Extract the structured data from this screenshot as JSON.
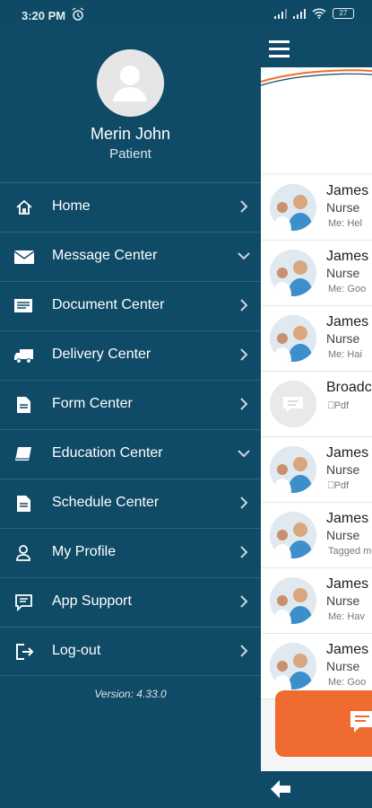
{
  "status": {
    "time": "3:20 PM",
    "battery": "27"
  },
  "drawer": {
    "user_name": "Merin John",
    "user_role": "Patient",
    "menu": [
      {
        "label": "Home",
        "icon": "home-icon",
        "chevron": "right"
      },
      {
        "label": "Message Center",
        "icon": "envelope-icon",
        "chevron": "down"
      },
      {
        "label": "Document Center",
        "icon": "document-icon",
        "chevron": "right"
      },
      {
        "label": "Delivery Center",
        "icon": "truck-icon",
        "chevron": "right"
      },
      {
        "label": "Form Center",
        "icon": "form-icon",
        "chevron": "right"
      },
      {
        "label": "Education Center",
        "icon": "book-icon",
        "chevron": "down"
      },
      {
        "label": "Schedule Center",
        "icon": "schedule-icon",
        "chevron": "right"
      },
      {
        "label": "My Profile",
        "icon": "profile-icon",
        "chevron": "right"
      },
      {
        "label": "App Support",
        "icon": "support-icon",
        "chevron": "right"
      },
      {
        "label": "Log-out",
        "icon": "logout-icon",
        "chevron": "right"
      }
    ],
    "version": "Version: 4.33.0"
  },
  "conversations": [
    {
      "name": "James",
      "role": "Nurse",
      "message": "Me: Hel",
      "type": "person"
    },
    {
      "name": "James",
      "role": "Nurse",
      "message": "Me: Goo",
      "type": "person"
    },
    {
      "name": "James",
      "role": "Nurse",
      "message": "Me: Hai",
      "type": "person"
    },
    {
      "name": "Broadc",
      "role": "",
      "message": "⎕Pdf",
      "type": "broadcast"
    },
    {
      "name": "James",
      "role": "Nurse",
      "message": "⎕Pdf",
      "type": "person"
    },
    {
      "name": "James",
      "role": "Nurse",
      "message": "Tagged m",
      "type": "person"
    },
    {
      "name": "James",
      "role": "Nurse",
      "message": "Me: Hav",
      "type": "person"
    },
    {
      "name": "James",
      "role": "Nurse",
      "message": "Me: Goo",
      "type": "person"
    }
  ],
  "colors": {
    "drawer_bg": "#0f4a66",
    "accent": "#ef6b2f",
    "divider": "#2c6580"
  }
}
